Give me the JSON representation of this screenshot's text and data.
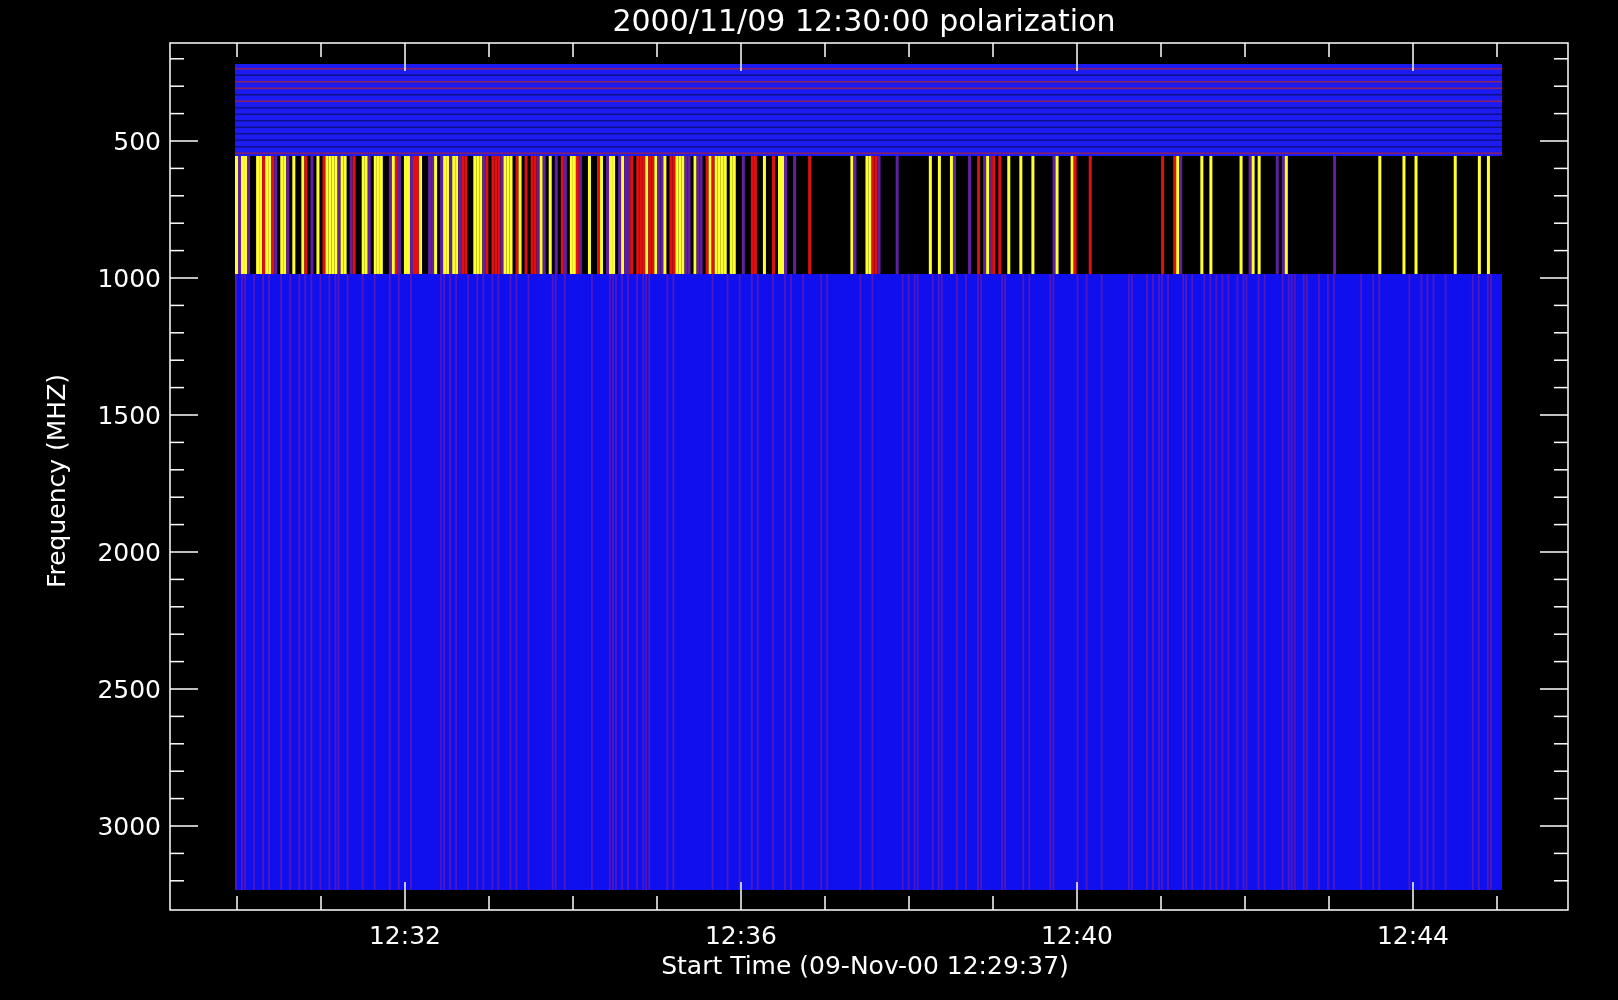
{
  "plot": {
    "title": "2000/11/09 12:30:00 polarization",
    "y_axis": {
      "label": "Frequency (MHZ)",
      "ticks": [
        "500",
        "1000",
        "1500",
        "2000",
        "2500",
        "3000"
      ]
    },
    "x_axis": {
      "label": "Start Time (09-Nov-00 12:29:37)",
      "ticks": [
        "12:32",
        "12:36",
        "12:40",
        "12:44"
      ]
    }
  }
}
